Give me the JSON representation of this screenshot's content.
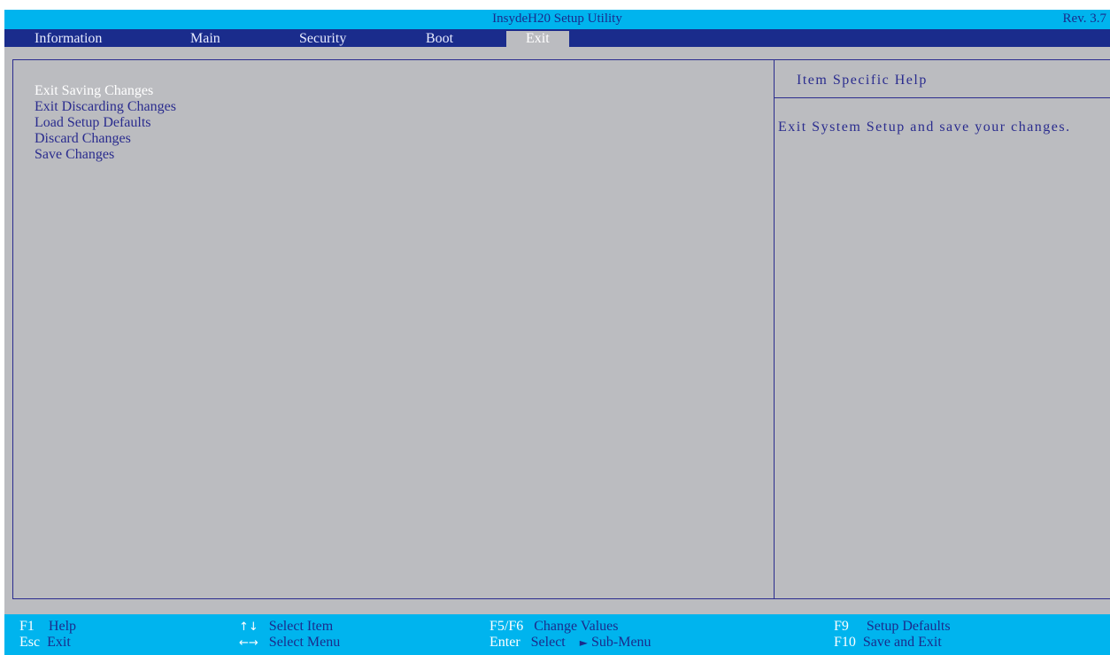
{
  "titlebar": {
    "title": "InsydeH20 Setup Utility",
    "revision": "Rev. 3.7"
  },
  "menu": {
    "items": [
      {
        "label": "Information"
      },
      {
        "label": "Main"
      },
      {
        "label": "Security"
      },
      {
        "label": "Boot"
      },
      {
        "label": "Exit",
        "active": true
      }
    ]
  },
  "options": [
    {
      "label": "Exit Saving Changes",
      "selected": true
    },
    {
      "label": "Exit Discarding Changes"
    },
    {
      "label": "Load Setup Defaults"
    },
    {
      "label": "Discard Changes"
    },
    {
      "label": "Save Changes"
    }
  ],
  "help": {
    "title": "Item Specific Help",
    "text": "Exit System Setup and save your changes."
  },
  "footer": {
    "f1_key": "F1",
    "f1_desc": "Help",
    "esc_key": "Esc",
    "esc_desc": "Exit",
    "updown_icon": "up-down-arrows-icon",
    "updown_glyph": "↑↓",
    "updown_desc": "Select Item",
    "leftright_icon": "left-right-arrows-icon",
    "leftright_glyph": "←→",
    "leftright_desc": "Select Menu",
    "f5f6_key": "F5/F6",
    "f5f6_desc": "Change Values",
    "enter_key": "Enter",
    "enter_desc": "Select",
    "submenu_glyph": "►",
    "submenu_desc": "Sub-Menu",
    "f9_key": "F9",
    "f9_desc": "Setup Defaults",
    "f10_key": "F10",
    "f10_desc": "Save and Exit"
  },
  "colors": {
    "accent_cyan": "#00b4ee",
    "navy": "#1a2c8c",
    "panel_gray": "#bbbcc0",
    "text_blue": "#2a2c8e"
  }
}
